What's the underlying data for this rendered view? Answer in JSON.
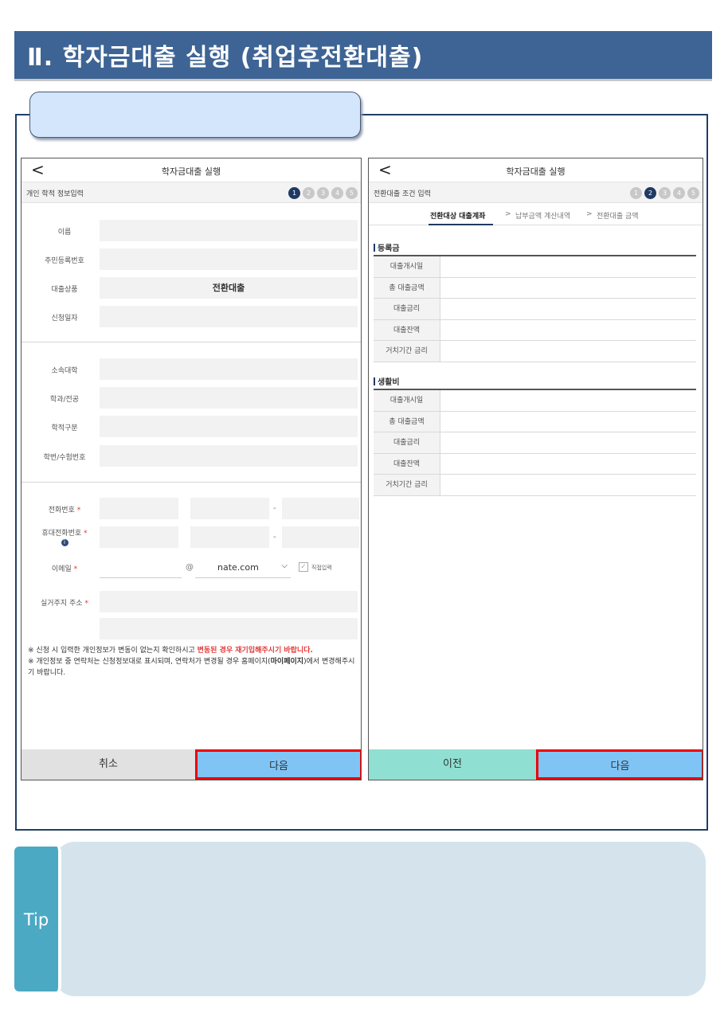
{
  "header": {
    "title": "Ⅱ. 학자금대출 실행 (취업후전환대출)"
  },
  "section_tab": {
    "label": ""
  },
  "left_panel": {
    "title": "학자금대출 실행",
    "step_label": "개인 학적 정보입력",
    "steps": [
      "1",
      "2",
      "3",
      "4",
      "5"
    ],
    "active_step": 1,
    "fields": {
      "name": "이름",
      "rrn": "주민등록번호",
      "product": "대출상품",
      "product_value": "전환대출",
      "apply_date": "신청일자",
      "university": "소속대학",
      "major": "학과/전공",
      "status": "학적구분",
      "student_id": "학번/수험번호",
      "phone": "전화번호",
      "mobile": "휴대전화번호",
      "email": "이메일",
      "address": "실거주지 주소"
    },
    "required_mark": "*",
    "dash": "-",
    "at": "@",
    "email_domain": "nate.com",
    "direct_input": "직접입력",
    "notes": {
      "mark": "※",
      "n1_a": "신청 시 입력한 개인정보가 변동이 없는지 확인하시고 ",
      "n1_b": "변동된 경우 재기입해주시기 바랍니다.",
      "n2_a": "개인정보 중 연락처는 신청정보대로 표시되며, 연락처가 변경될 경우 홈페이지(",
      "n2_b": "마이페이지",
      "n2_c": ")에서 변경해주시기 바랍니다."
    },
    "cancel": "취소",
    "next": "다음"
  },
  "right_panel": {
    "title": "학자금대출 실행",
    "step_label": "전환대출 조건 입력",
    "steps": [
      "1",
      "2",
      "3",
      "4",
      "5"
    ],
    "active_step": 2,
    "tabs": [
      "전환대상 대출계좌",
      "납부금액 계산내역",
      "전환대출 금액"
    ],
    "tab_sep": ">",
    "sections": [
      {
        "title": "등록금",
        "rows": [
          "대출개시일",
          "총 대출금액",
          "대출금리",
          "대출잔액",
          "거치기간 금리"
        ]
      },
      {
        "title": "생활비",
        "rows": [
          "대출개시일",
          "총 대출금액",
          "대출금리",
          "대출잔액",
          "거치기간 금리"
        ]
      }
    ],
    "prev": "이전",
    "next": "다음"
  },
  "tip": {
    "label": "Tip"
  },
  "colors": {
    "header": "#3d6494",
    "accent": "#1f3a63",
    "next_button": "#80c4f6",
    "prev_button": "#8fe0d2",
    "highlight": "#ee0000"
  },
  "icons": [
    "back-arrow-icon",
    "info-icon",
    "chevron-down-icon",
    "checkbox-icon"
  ]
}
